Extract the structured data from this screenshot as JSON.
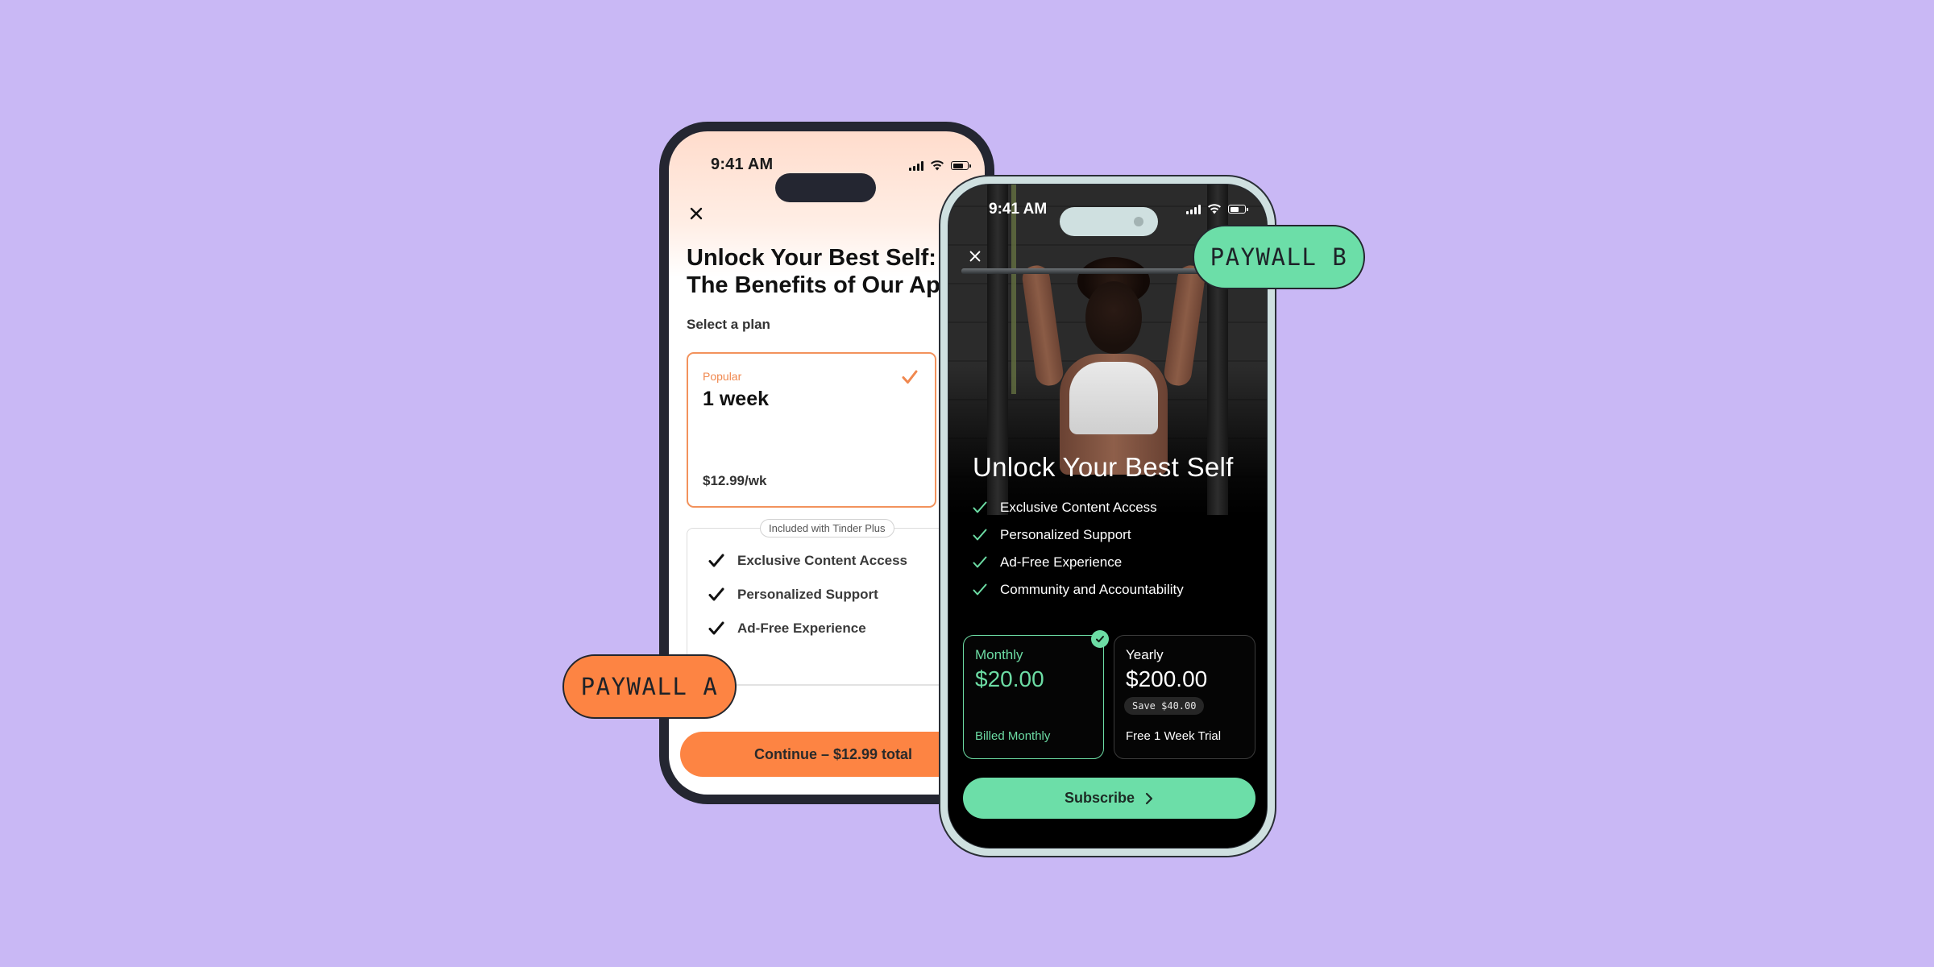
{
  "background_color": "#c9b8f5",
  "paywall_a": {
    "badge_label": "PAYWALL A",
    "badge_color": "#fd8443",
    "status_bar": {
      "time": "9:41 AM",
      "icons": [
        "cellular-signal-icon",
        "wifi-icon",
        "battery-icon"
      ]
    },
    "close_icon": "close-icon",
    "title_line1": "Unlock Your Best Self:",
    "title_line2": "The Benefits of Our Ap",
    "select_label": "Select a plan",
    "plan": {
      "tag": "Popular",
      "duration": "1 week",
      "price": "$12.99/wk",
      "selected": true,
      "accent_color": "#f0884f"
    },
    "included_label": "Included with Tinder Plus",
    "features": [
      "Exclusive Content Access",
      "Personalized Support",
      "Ad-Free Experience"
    ],
    "cta_label": "Continue – $12.99 total"
  },
  "paywall_b": {
    "badge_label": "PAYWALL B",
    "badge_color": "#6cdea8",
    "status_bar": {
      "time": "9:41 AM",
      "icons": [
        "cellular-signal-icon",
        "wifi-icon",
        "battery-icon"
      ]
    },
    "close_icon": "close-icon",
    "hero_image": "woman-lifting-barbell-photo",
    "title": "Unlock Your Best Self",
    "features": [
      "Exclusive Content Access",
      "Personalized Support",
      "Ad-Free Experience",
      "Community and Accountability"
    ],
    "plans": [
      {
        "name": "Monthly",
        "price": "$20.00",
        "note": "Billed Monthly",
        "selected": true
      },
      {
        "name": "Yearly",
        "price": "$200.00",
        "savings": "Save $40.00",
        "note": "Free 1 Week Trial",
        "selected": false
      }
    ],
    "cta_label": "Subscribe",
    "accent_color": "#6cdca4"
  }
}
